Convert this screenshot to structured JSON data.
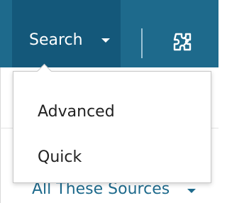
{
  "nav": {
    "search_label": "Search",
    "tool_icon": "puzzle-tool-icon"
  },
  "dropdown": {
    "items": [
      {
        "label": "Advanced"
      },
      {
        "label": "Quick"
      }
    ]
  },
  "background": {
    "sources_label": "All These Sources"
  },
  "colors": {
    "navbar": "#1e6a8c",
    "navbar_active": "#14587a",
    "text_dark": "#222222",
    "link_blue": "#1e6a8c"
  }
}
